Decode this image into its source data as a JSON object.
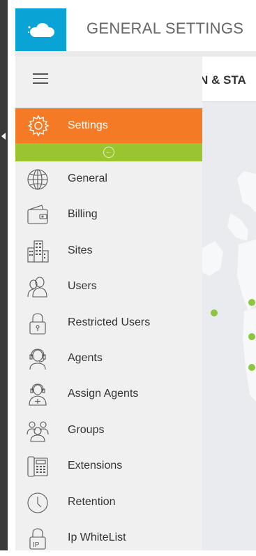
{
  "header": {
    "title": "GENERAL SETTINGS"
  },
  "content": {
    "tab_fragment": "N & STA"
  },
  "sidebar": {
    "active": {
      "label": "Settings",
      "icon": "gear-icon"
    },
    "collapse_icon": "arrow-left-circle-icon",
    "items": [
      {
        "label": "General",
        "icon": "globe-icon"
      },
      {
        "label": "Billing",
        "icon": "wallet-icon"
      },
      {
        "label": "Sites",
        "icon": "building-icon"
      },
      {
        "label": "Users",
        "icon": "users-icon"
      },
      {
        "label": "Restricted Users",
        "icon": "lock-icon"
      },
      {
        "label": "Agents",
        "icon": "headset-agent-icon"
      },
      {
        "label": "Assign Agents",
        "icon": "assign-agent-icon"
      },
      {
        "label": "Groups",
        "icon": "group-icon"
      },
      {
        "label": "Extensions",
        "icon": "phone-extension-icon"
      },
      {
        "label": "Retention",
        "icon": "clock-icon"
      },
      {
        "label": "Ip WhiteList",
        "icon": "ip-lock-icon"
      }
    ]
  },
  "colors": {
    "logo_bg": "#0aa3d5",
    "active_item": "#f47a25",
    "collapse_bar": "#9ac52e",
    "map_dots": "#8cc63f"
  }
}
